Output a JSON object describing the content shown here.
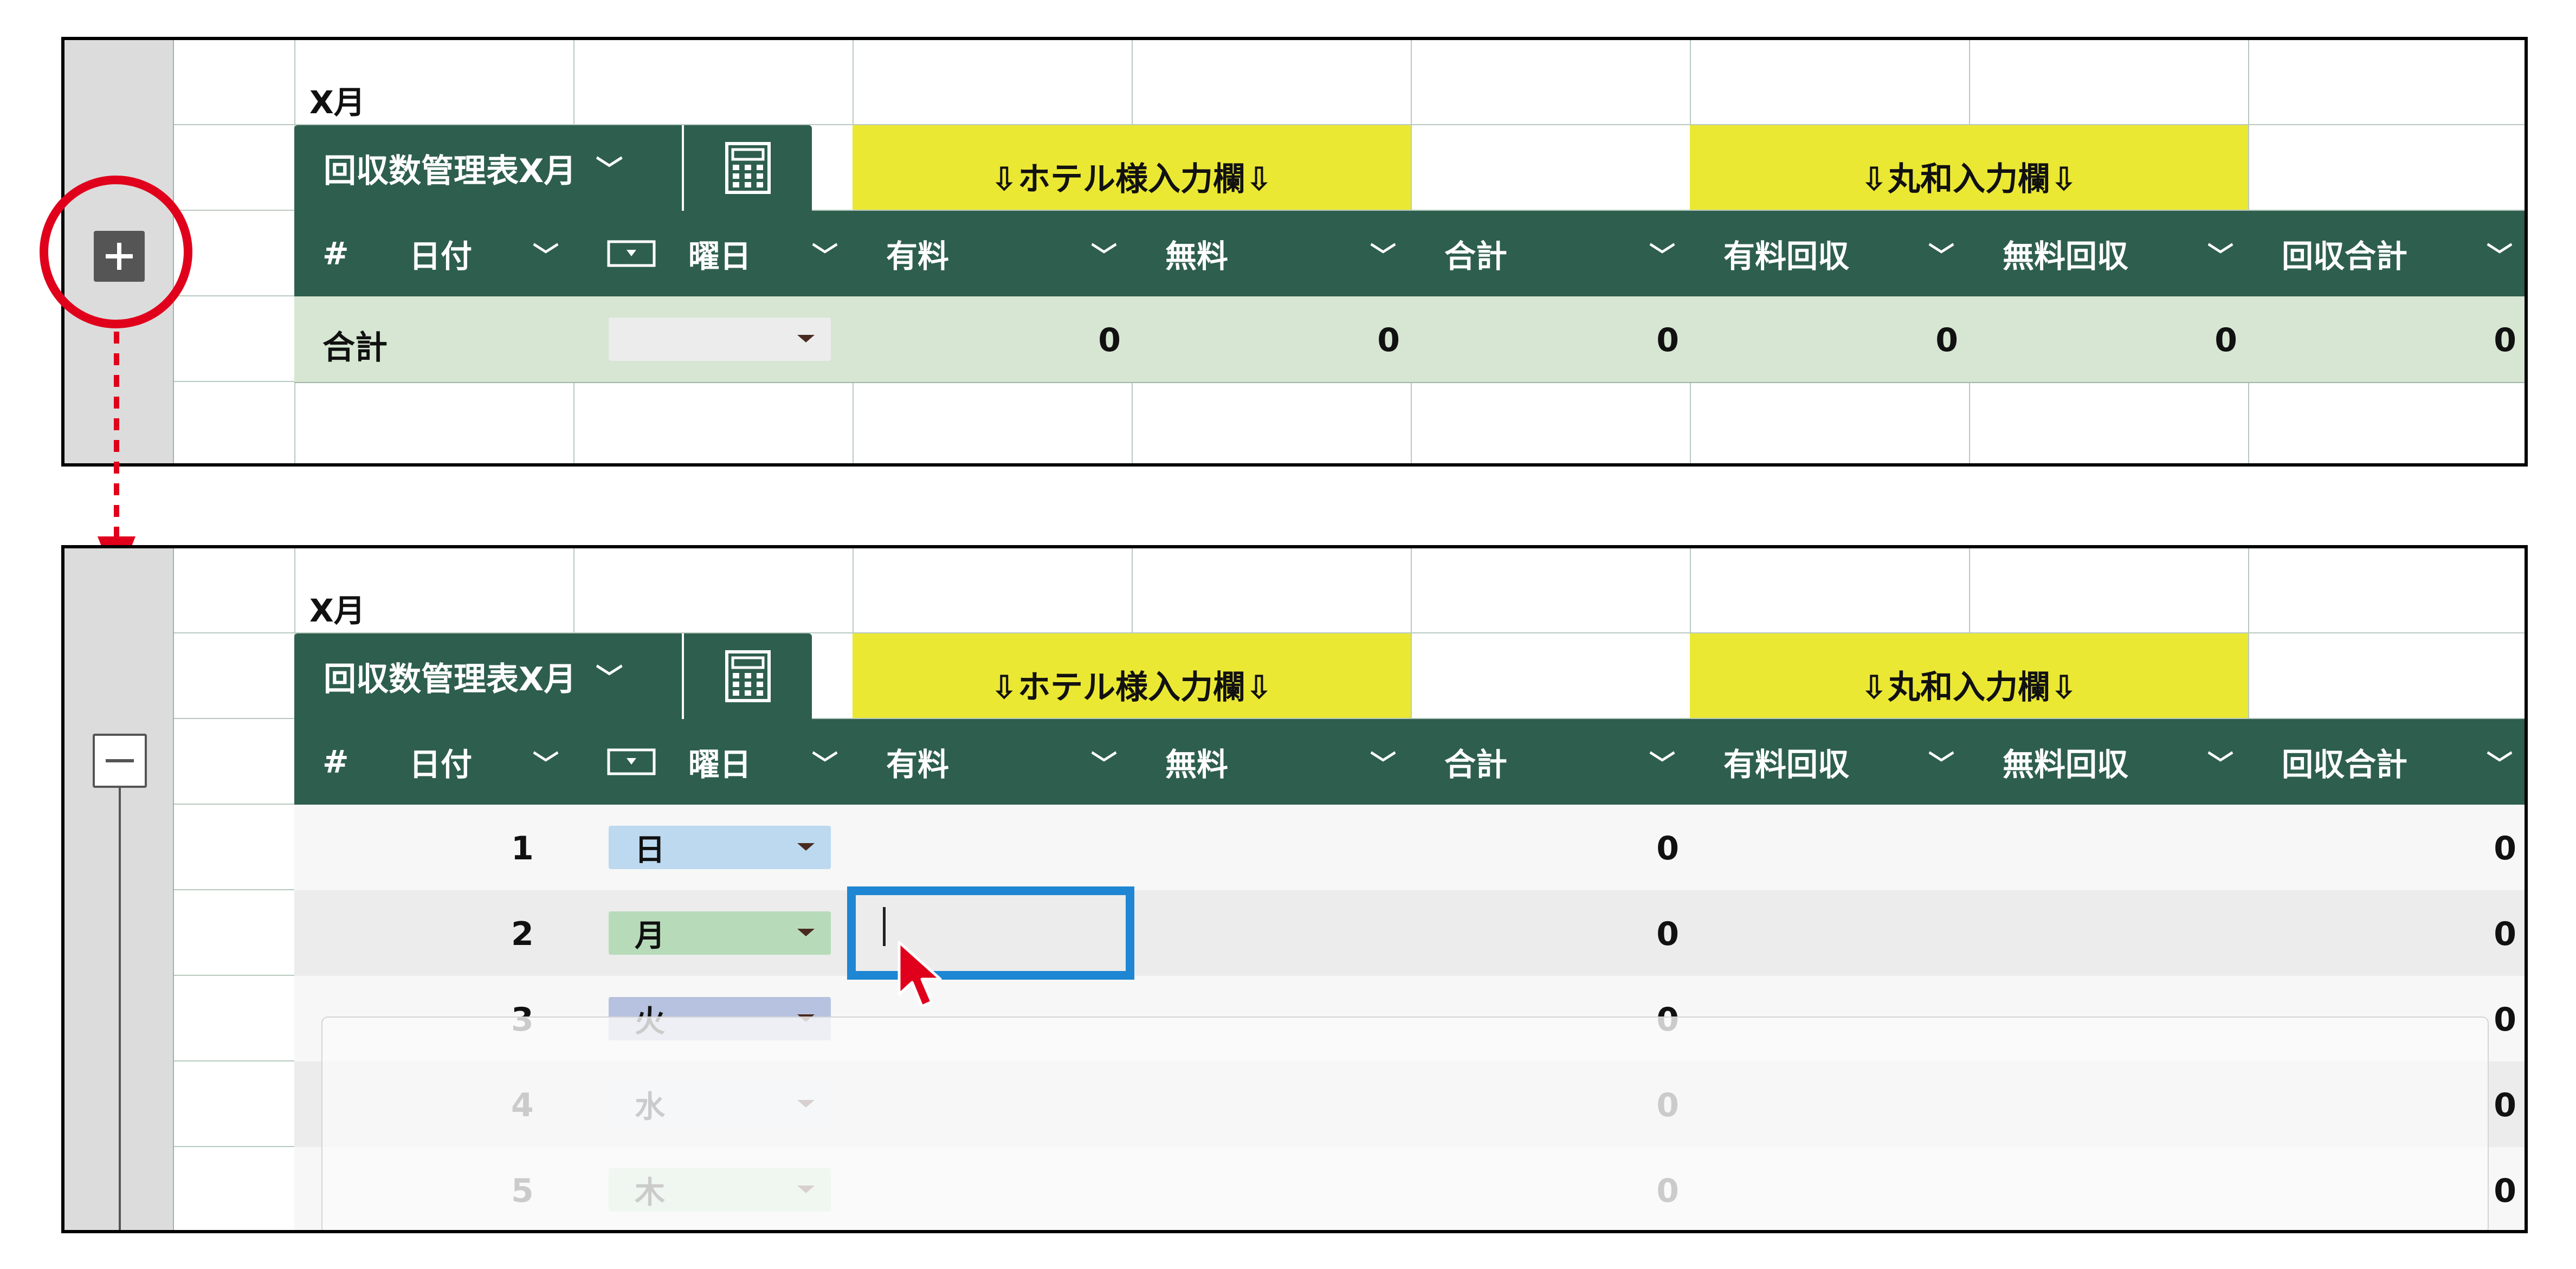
{
  "title": "X月",
  "table_name": "回収数管理表X月",
  "banner_hotel": "⇩ホテル様入力欄⇩",
  "banner_maruwa": "⇩丸和入力欄⇩",
  "columns": {
    "hash": "#",
    "date": "日付",
    "weekday": "曜日",
    "paid": "有料",
    "free": "無料",
    "total": "合計",
    "paid_collect": "有料回収",
    "free_collect": "無料回収",
    "collect_total": "回収合計"
  },
  "totals_row": {
    "label": "合計",
    "values": [
      "0",
      "0",
      "0",
      "0",
      "0",
      "0"
    ]
  },
  "rows": [
    {
      "day": "1",
      "weekday": "日",
      "total": "0",
      "collect_total": "0"
    },
    {
      "day": "2",
      "weekday": "月",
      "total": "0",
      "collect_total": "0"
    },
    {
      "day": "3",
      "weekday": "火",
      "total": "0",
      "collect_total": "0"
    },
    {
      "day": "4",
      "weekday": "水",
      "total": "0",
      "collect_total": "0"
    },
    {
      "day": "5",
      "weekday": "木",
      "total": "0",
      "collect_total": "0"
    }
  ],
  "colors": {
    "header_green": "#2e5e4e",
    "total_row_green": "#d6e6d2",
    "banner_yellow": "#ebe834",
    "highlight_red": "#e0001b",
    "selection_blue": "#1e86d3",
    "weekday_sun": "#bcd9f0",
    "weekday_mon": "#b7dbb9",
    "weekday_tue": "#b7c2e0",
    "weekday_wed": "#e3ebf2",
    "weekday_thu": "#c6e6c6"
  },
  "icons": [
    "expand-plus-icon",
    "collapse-minus-icon",
    "calculator-icon",
    "dropdown-chevron-icon",
    "mouse-cursor-icon",
    "text-caret-icon",
    "arrow-down-icon"
  ]
}
